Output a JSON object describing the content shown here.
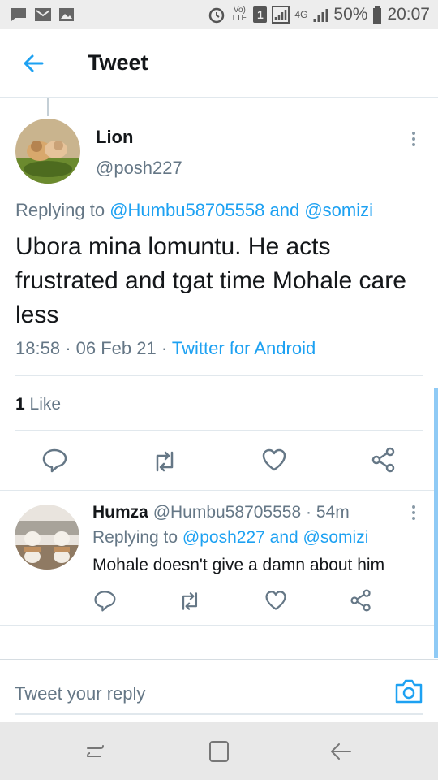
{
  "status_bar": {
    "volte_label": "Vo) LTE",
    "sim_badge": "1",
    "network_label": "4G",
    "battery_percent": "50%",
    "time": "20:07"
  },
  "header": {
    "title": "Tweet"
  },
  "tweet": {
    "author_name": "Lion",
    "author_handle": "@posh227",
    "replying_prefix": "Replying to",
    "replying_to_1": "@Humbu58705558",
    "replying_and": "and",
    "replying_to_2": "@somizi",
    "text": "Ubora mina lomuntu. He acts frustrated and tgat time Mohale care less",
    "time": "18:58",
    "date": "06 Feb 21",
    "separator": "·",
    "source": "Twitter for Android",
    "like_count": "1",
    "like_label": "Like"
  },
  "reply": {
    "author_name": "Humza",
    "author_handle": "@Humbu58705558",
    "separator": "·",
    "time_ago": "54m",
    "replying_prefix": "Replying to",
    "replying_to_1": "@posh227",
    "replying_and": "and",
    "replying_to_2": "@somizi",
    "text": "Mohale doesn't give a damn about him"
  },
  "composer": {
    "placeholder": "Tweet your reply"
  },
  "colors": {
    "accent": "#1da1f2",
    "secondary_text": "#657786",
    "divider": "#e1e8ed"
  }
}
